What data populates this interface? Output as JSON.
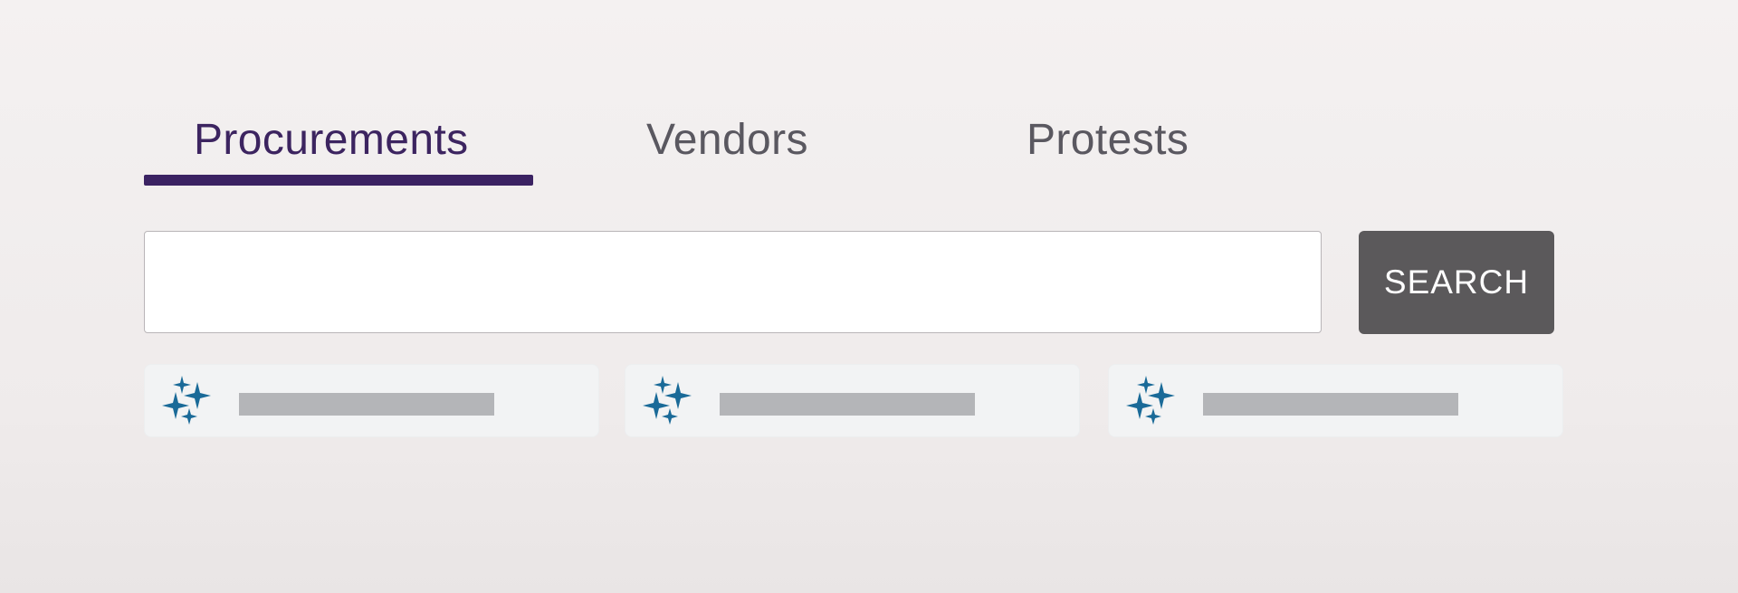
{
  "tabs": {
    "items": [
      {
        "label": "Procurements",
        "active": true
      },
      {
        "label": "Vendors",
        "active": false
      },
      {
        "label": "Protests",
        "active": false
      }
    ]
  },
  "search": {
    "value": "",
    "placeholder": "",
    "button_label": "SEARCH"
  },
  "suggestions": [
    {
      "icon": "sparkles-icon"
    },
    {
      "icon": "sparkles-icon"
    },
    {
      "icon": "sparkles-icon"
    }
  ],
  "colors": {
    "active_tab": "#3c2460",
    "inactive_tab": "#5a5860",
    "underline": "#3b2262",
    "button_bg": "#5b595b",
    "sparkle": "#1a6a98",
    "suggestion_bg": "#f2f3f4",
    "placeholder_bar": "#b4b5b8"
  }
}
